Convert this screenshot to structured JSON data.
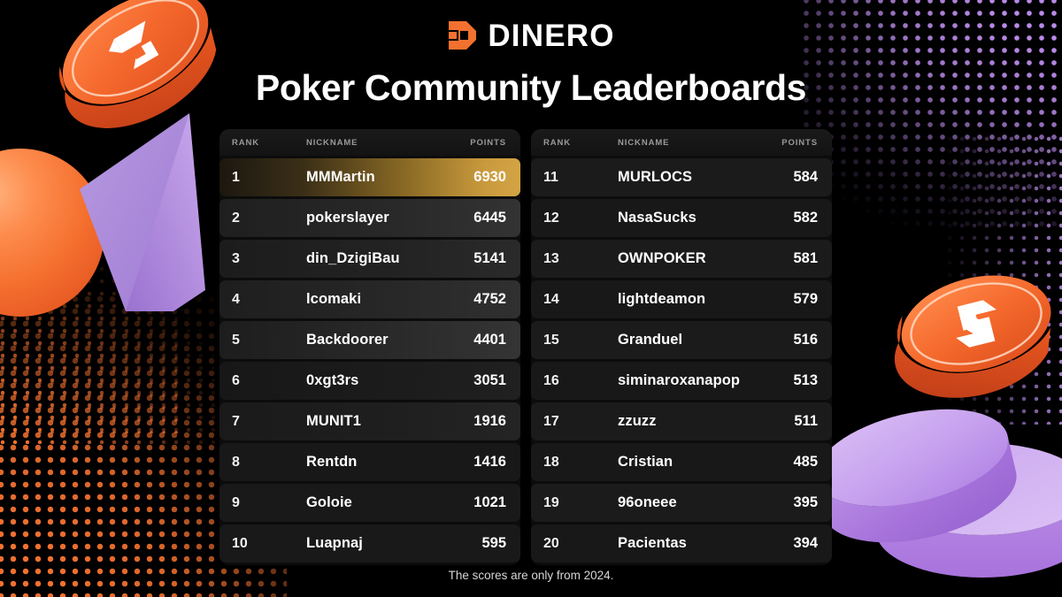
{
  "brand": {
    "logo_icon": "dinero-d-logo-icon",
    "name": "DINERO"
  },
  "page_title": "Poker Community Leaderboards",
  "footnote": "The scores are only from 2024.",
  "colors": {
    "background": "#000000",
    "accent_orange": "#f2712f",
    "accent_purple": "#b98ae8",
    "gold_highlight": "#d3a444",
    "row_background": "#1b1b1b",
    "text_primary": "#ffffff",
    "text_muted": "#9a9a9a"
  },
  "columns": {
    "rank": "RANK",
    "nickname": "NICKNAME",
    "points": "POINTS"
  },
  "leaderboard_left": [
    {
      "rank": "1",
      "nickname": "MMMartin",
      "points": "6930"
    },
    {
      "rank": "2",
      "nickname": "pokerslayer",
      "points": "6445"
    },
    {
      "rank": "3",
      "nickname": "din_DzigiBau",
      "points": "5141"
    },
    {
      "rank": "4",
      "nickname": "lcomaki",
      "points": "4752"
    },
    {
      "rank": "5",
      "nickname": "Backdoorer",
      "points": "4401"
    },
    {
      "rank": "6",
      "nickname": "0xgt3rs",
      "points": "3051"
    },
    {
      "rank": "7",
      "nickname": "MUNIT1",
      "points": "1916"
    },
    {
      "rank": "8",
      "nickname": "Rentdn",
      "points": "1416"
    },
    {
      "rank": "9",
      "nickname": "Goloie",
      "points": "1021"
    },
    {
      "rank": "10",
      "nickname": "Luapnaj",
      "points": "595"
    }
  ],
  "leaderboard_right": [
    {
      "rank": "11",
      "nickname": "MURLOCS",
      "points": "584"
    },
    {
      "rank": "12",
      "nickname": "NasaSucks",
      "points": "582"
    },
    {
      "rank": "13",
      "nickname": "OWNPOKER",
      "points": "581"
    },
    {
      "rank": "14",
      "nickname": "lightdeamon",
      "points": "579"
    },
    {
      "rank": "15",
      "nickname": "Granduel",
      "points": "516"
    },
    {
      "rank": "16",
      "nickname": "siminaroxanapop",
      "points": "513"
    },
    {
      "rank": "17",
      "nickname": "zzuzz",
      "points": "511"
    },
    {
      "rank": "18",
      "nickname": "Cristian",
      "points": "485"
    },
    {
      "rank": "19",
      "nickname": "96oneee",
      "points": "395"
    },
    {
      "rank": "20",
      "nickname": "Pacientas",
      "points": "394"
    }
  ],
  "decor": {
    "coin_top_left": "dinero-coin-icon",
    "coin_bottom_right": "dinero-coin-icon",
    "sphere": "orange-sphere-shape",
    "cone": "purple-cone-shape",
    "cylinders": "purple-cylinder-shapes",
    "dots_purple": "purple-halftone-dots",
    "dots_orange": "orange-halftone-dots"
  }
}
